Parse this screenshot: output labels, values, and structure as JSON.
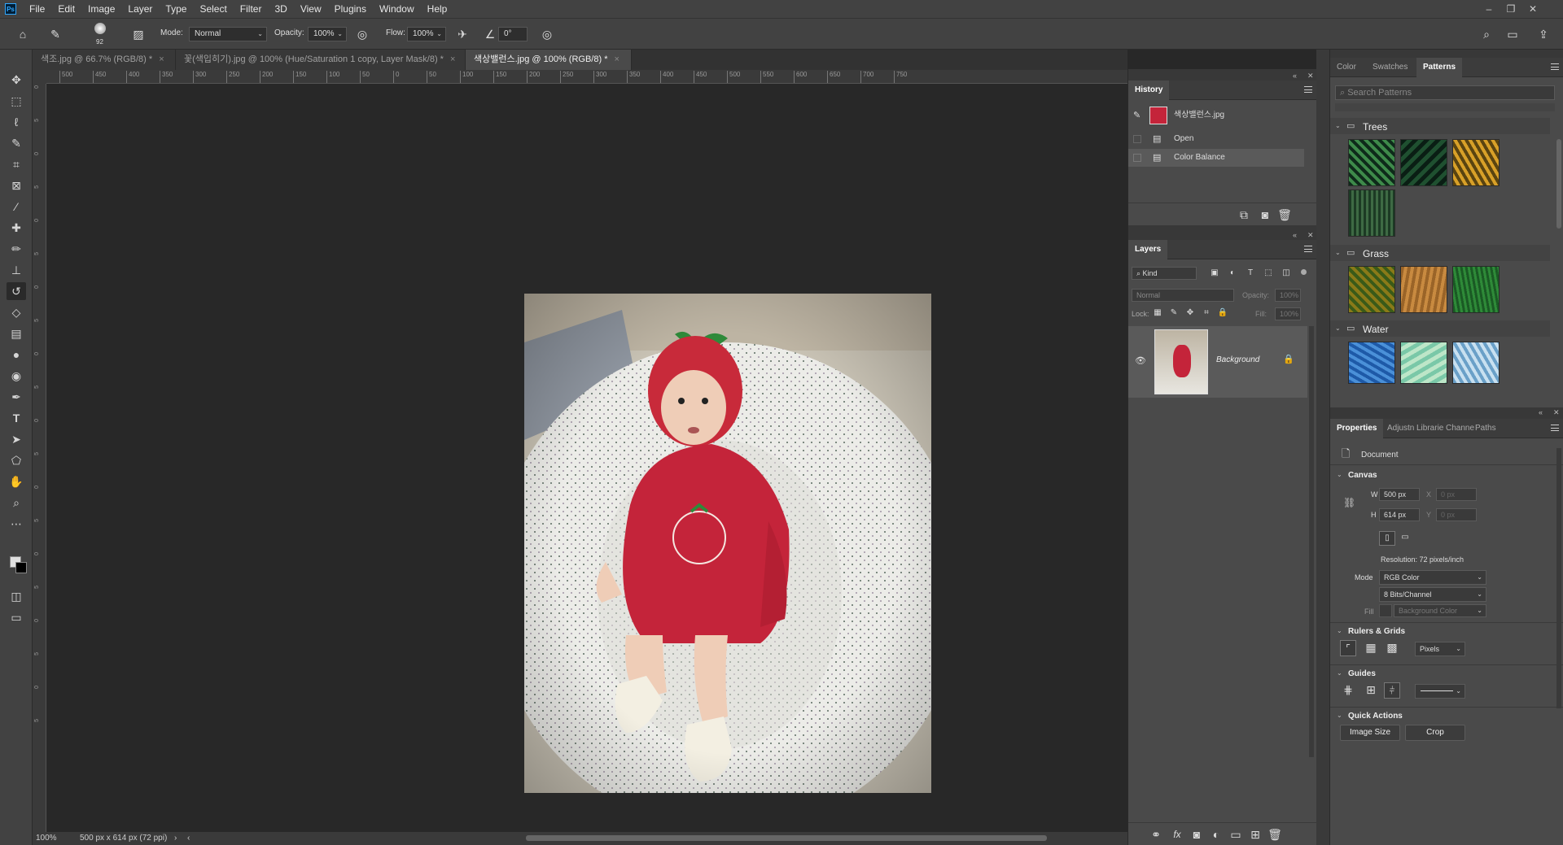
{
  "menubar": {
    "items": [
      "File",
      "Edit",
      "Image",
      "Layer",
      "Type",
      "Select",
      "Filter",
      "3D",
      "View",
      "Plugins",
      "Window",
      "Help"
    ],
    "logo": "Ps"
  },
  "options": {
    "brush_size": "92",
    "mode_label": "Mode:",
    "mode_value": "Normal",
    "opacity_label": "Opacity:",
    "opacity_value": "100%",
    "flow_label": "Flow:",
    "flow_value": "100%",
    "angle_value": "0°"
  },
  "tabs": [
    {
      "label": "색조.jpg @ 66.7% (RGB/8) *"
    },
    {
      "label": "꽃(색입히기).jpg @ 100% (Hue/Saturation 1 copy, Layer Mask/8) *"
    },
    {
      "label": "색상밸런스.jpg @ 100% (RGB/8) *"
    }
  ],
  "ruler_top": [
    "500",
    "450",
    "400",
    "350",
    "300",
    "250",
    "200",
    "150",
    "100",
    "50",
    "0",
    "50",
    "100",
    "150",
    "200",
    "250",
    "300",
    "350",
    "400",
    "450",
    "500",
    "550",
    "600",
    "650",
    "700",
    "750"
  ],
  "ruler_left": [
    "0",
    "5",
    "0",
    "5",
    "0",
    "5",
    "0",
    "5",
    "0",
    "5",
    "0",
    "5",
    "0",
    "5",
    "0",
    "5",
    "0",
    "5",
    "0",
    "5"
  ],
  "status": {
    "zoom": "100%",
    "doc_info": "500 px x 614 px (72 ppi)"
  },
  "history": {
    "title": "History",
    "snapshot_name": "색상밸런스.jpg",
    "items": [
      "Open",
      "Color Balance"
    ]
  },
  "layers": {
    "title": "Layers",
    "kind_placeholder": "Kind",
    "blend_mode": "Normal",
    "opacity_label": "Opacity:",
    "opacity_value": "100%",
    "lock_label": "Lock:",
    "fill_label": "Fill:",
    "fill_value": "100%",
    "layer_name": "Background"
  },
  "right_top": {
    "tabs": [
      "Color",
      "Swatches",
      "Patterns"
    ],
    "search_placeholder": "Search Patterns",
    "groups": [
      {
        "name": "Trees"
      },
      {
        "name": "Grass"
      },
      {
        "name": "Water"
      }
    ]
  },
  "properties": {
    "tabs": [
      "Properties",
      "Adjustn",
      "Librarie",
      "Channe",
      "Paths"
    ],
    "doc_label": "Document",
    "canvas_title": "Canvas",
    "w_label": "W",
    "w_value": "500 px",
    "h_label": "H",
    "h_value": "614 px",
    "x_label": "X",
    "x_value": "0 px",
    "y_label": "Y",
    "y_value": "0 px",
    "resolution": "Resolution: 72 pixels/inch",
    "mode_label": "Mode",
    "mode_value": "RGB Color",
    "bits_value": "8 Bits/Channel",
    "fill_label": "Fill",
    "fill_value": "Background Color",
    "rulers_title": "Rulers & Grids",
    "units_value": "Pixels",
    "guides_title": "Guides",
    "quick_title": "Quick Actions",
    "image_size_btn": "Image Size",
    "crop_btn": "Crop"
  }
}
